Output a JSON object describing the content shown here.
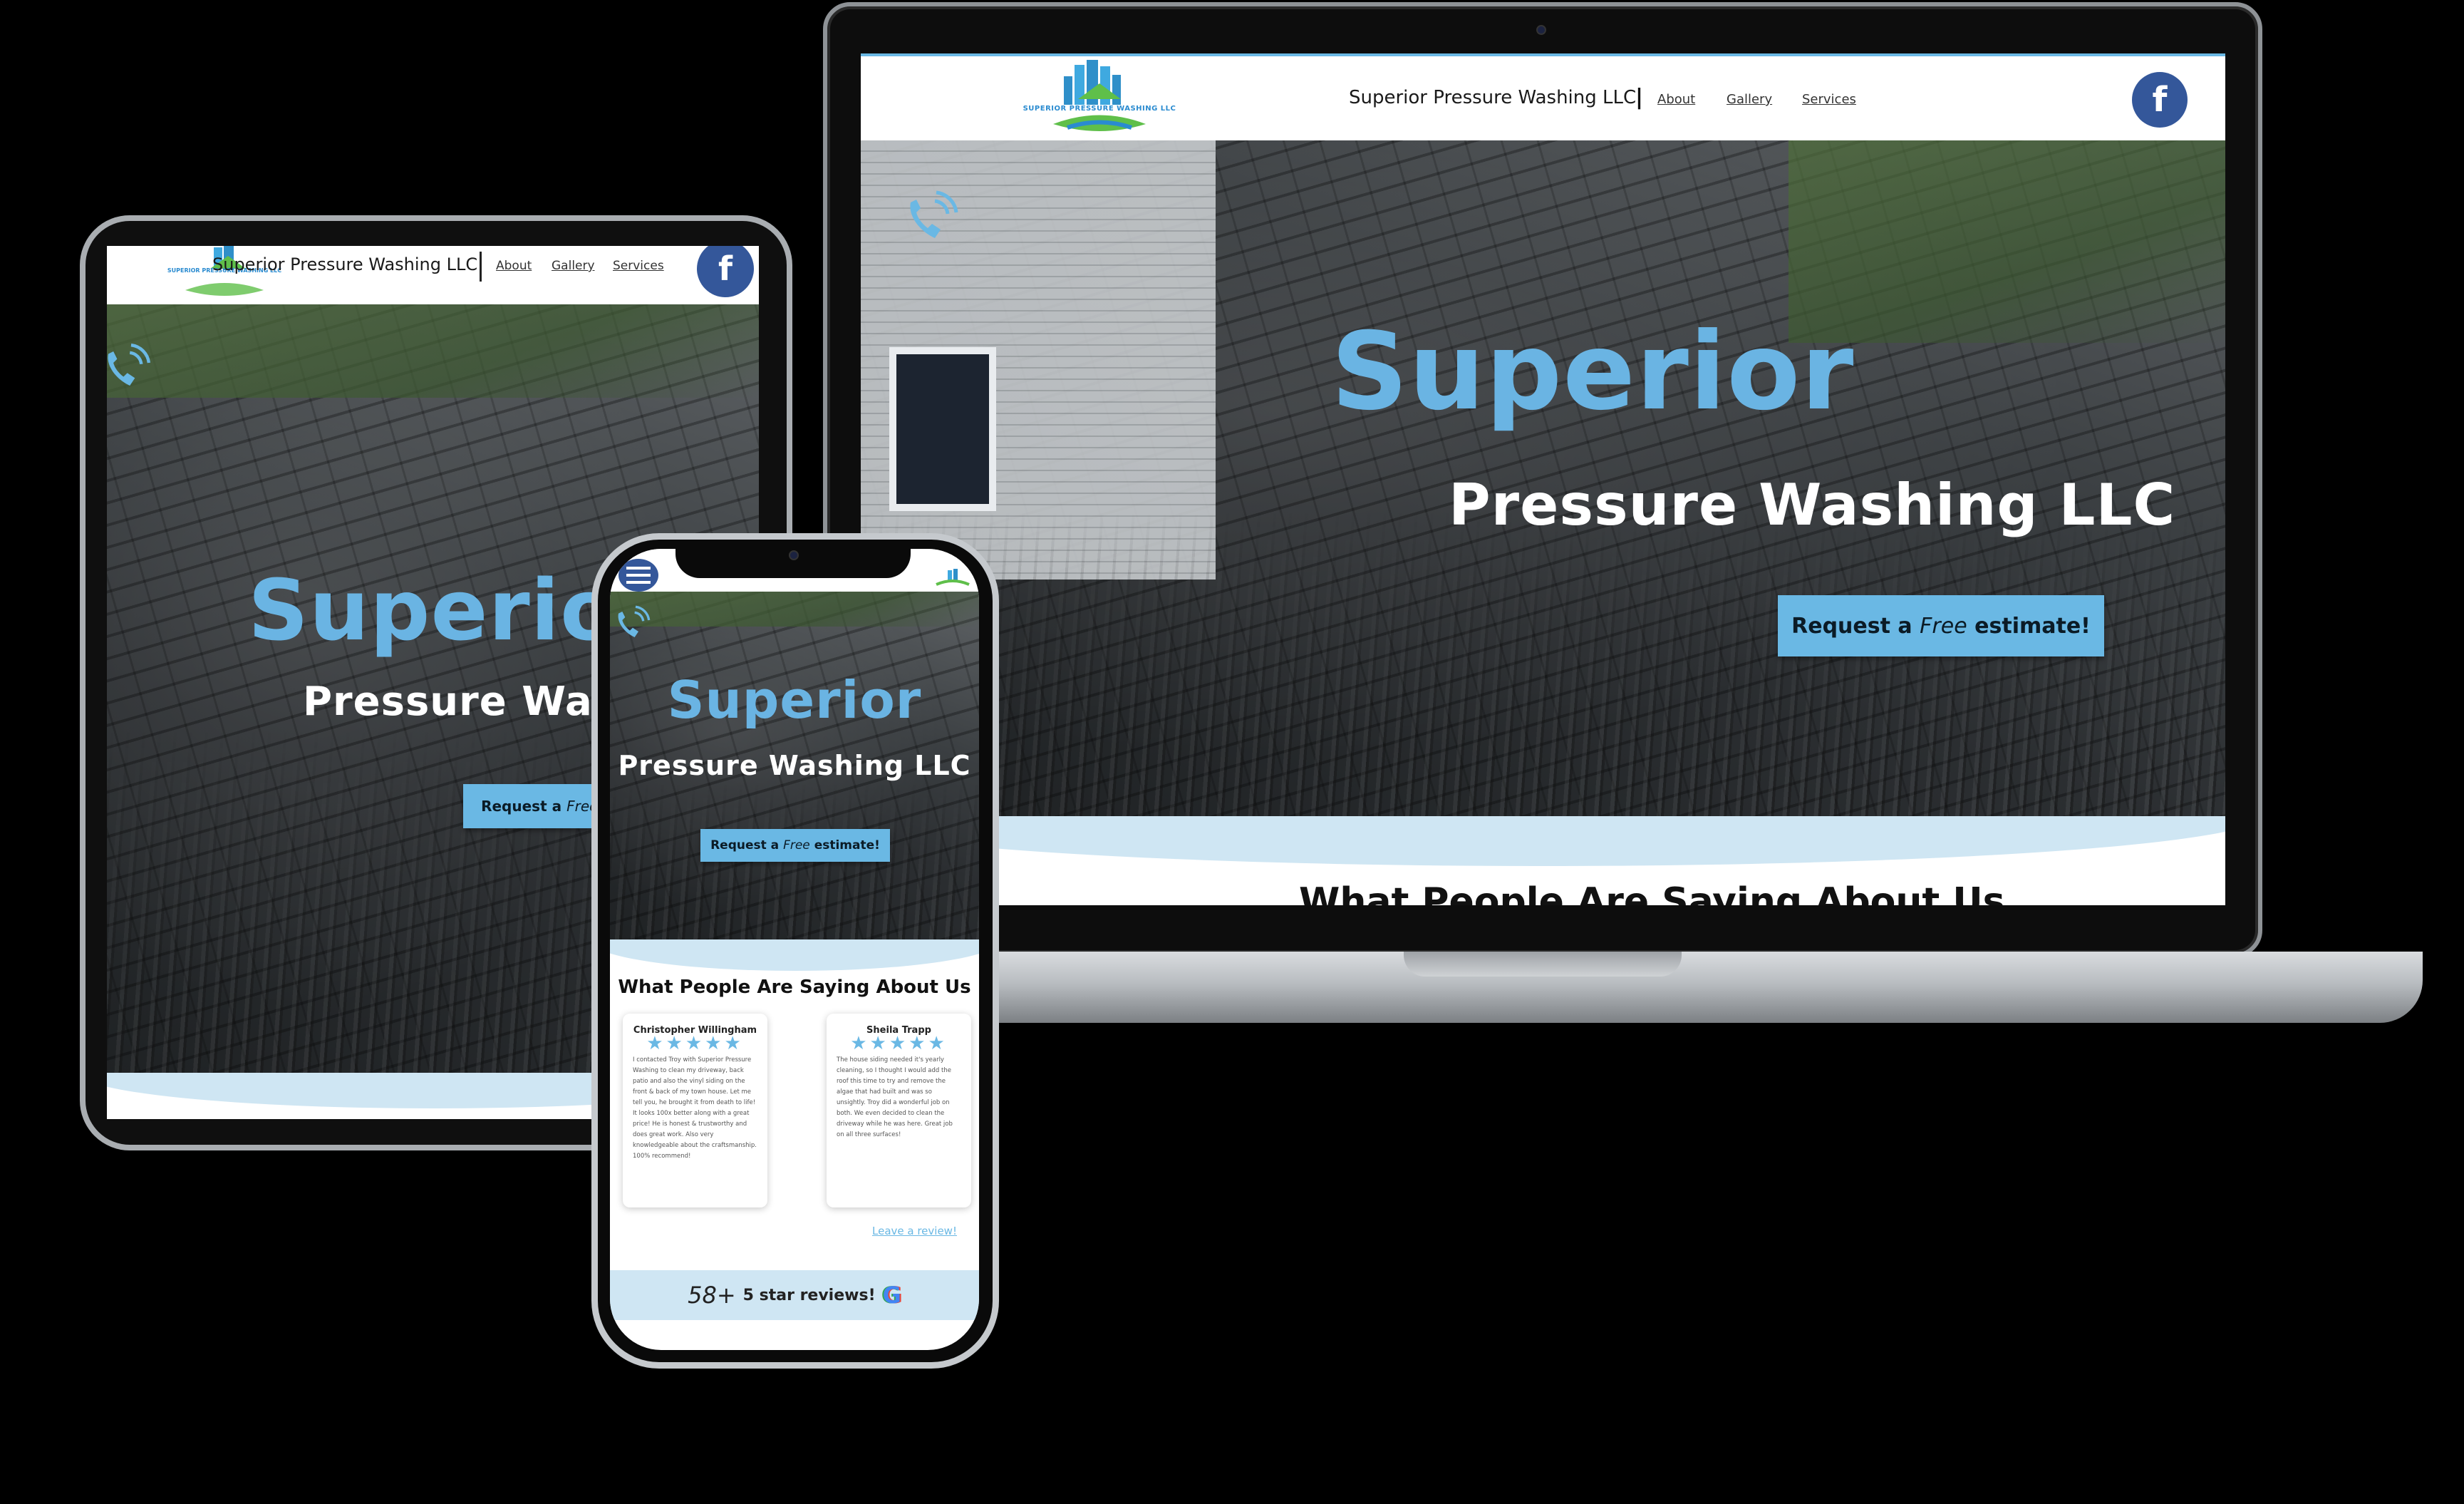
{
  "brand": {
    "logo_text": "SUPERIOR PRESSURE WASHING LLC",
    "site_title": "Superior Pressure Washing LLC",
    "accent_color": "#6ab8e4",
    "facebook_color": "#34579a"
  },
  "nav": {
    "separator": "|",
    "links": [
      "About",
      "Gallery",
      "Services"
    ]
  },
  "hero": {
    "title": "Superior",
    "subtitle": "Pressure Washing LLC",
    "cta_prefix": "Request a",
    "cta_emphasis": "Free",
    "cta_suffix": "estimate!"
  },
  "reviews": {
    "heading": "What People Are Saying About Us",
    "items": [
      {
        "name": "Christopher Willingham",
        "stars": "★★★★★",
        "text": "I contacted Troy with Superior Pressure Washing to clean my driveway, back patio and also the vinyl siding on the front & back of my town house. Let me tell you, he brought it from death to life! It looks 100x better along with a great price! He is honest & trustworthy and does great work. Also very knowledgeable about the craftsmanship. 100% recommend!"
      },
      {
        "name": "Sheila Trapp",
        "stars": "★★★★★",
        "text": "The house siding needed it's yearly cleaning, so I thought I would add the roof this time to try and remove the algae that had built and was so unsightly. Troy did a wonderful job on both. We even decided to clean the driveway while he was here. Great job on all three surfaces!"
      }
    ],
    "leave_review": "Leave a review!",
    "count_number": "58+",
    "count_label": "5 star reviews!",
    "google_letter": "G"
  },
  "icons": {
    "facebook": "facebook-icon",
    "phone": "phone-icon",
    "menu": "hamburger-menu-icon",
    "google": "google-icon"
  }
}
